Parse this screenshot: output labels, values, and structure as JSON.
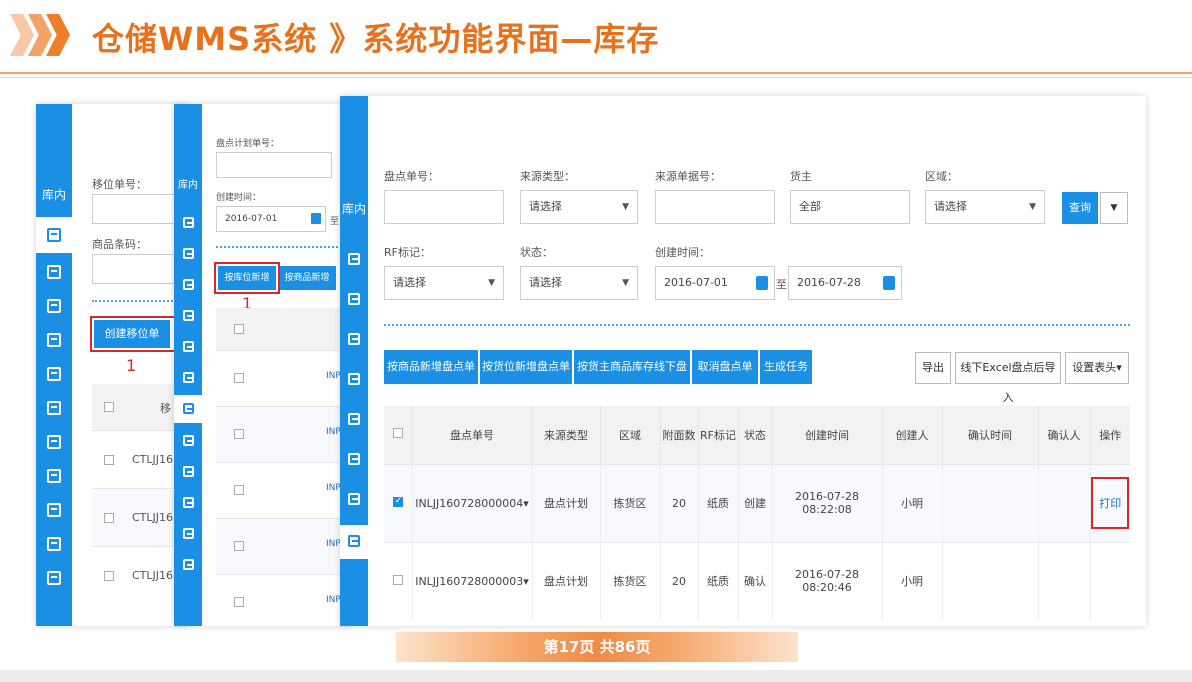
{
  "header": {
    "title": "仓储WMS系统 》系统功能界面—库存",
    "colors": {
      "accent": "#e8711c",
      "brand_blue": "#1a8fe3",
      "highlight_red": "#d9262c"
    }
  },
  "panel_left": {
    "sidebar_title": "库内",
    "field1_label": "移位单号：",
    "field2_label": "商品条码：",
    "create_button": "创建移位单",
    "step_number": "1",
    "table_header_partial": "移",
    "rows": [
      "CTLJJ16(",
      "CTLJJ16(",
      "CTLJJ16("
    ]
  },
  "panel_middle": {
    "sidebar_title": "库内",
    "field1_label": "盘点计划单号：",
    "field2_label": "创建时间：",
    "date_value": "2016-07-01",
    "date_suffix": "至",
    "btn_by_location": "按库位新增",
    "btn_by_product": "按商品新增",
    "step_number": "1",
    "row_prefix": "INPI"
  },
  "panel_main": {
    "sidebar_title": "库内",
    "filters": {
      "order_no_label": "盘点单号：",
      "source_type_label": "来源类型：",
      "source_type_value": "请选择",
      "source_no_label": "来源单据号：",
      "owner_label": "货主",
      "owner_value": "全部",
      "area_label": "区域：",
      "area_value": "请选择",
      "query_button": "查询",
      "rf_label": "RF标记：",
      "rf_value": "请选择",
      "status_label": "状态：",
      "status_value": "请选择",
      "created_label": "创建时间：",
      "date_from": "2016-07-01",
      "date_to_sep": "至",
      "date_to": "2016-07-28"
    },
    "toolbar": {
      "btn1": "按商品新增盘点单",
      "btn2": "按货位新增盘点单",
      "btn3": "按货主商品库存线下盘点",
      "btn4": "取消盘点单",
      "btn5": "生成任务",
      "export": "导出",
      "import": "线下Excel盘点后导入",
      "settings": "设置表头▾"
    },
    "table": {
      "columns": [
        "盘点单号",
        "来源类型",
        "区域",
        "附面数",
        "RF标记",
        "状态",
        "创建时间",
        "创建人",
        "确认时间",
        "确认人",
        "操作"
      ],
      "rows": [
        {
          "no": "INLJJ160728000004▾",
          "source": "盘点计划",
          "area": "拣货区",
          "count": "20",
          "rf": "纸质",
          "status": "创建",
          "created": "2016-07-28 08:22:08",
          "creator": "小明",
          "confirm_time": "",
          "confirmer": "",
          "op": "打印",
          "checked": true
        },
        {
          "no": "INLJJ160728000003▾",
          "source": "盘点计划",
          "area": "拣货区",
          "count": "20",
          "rf": "纸质",
          "status": "确认",
          "created": "2016-07-28 08:20:46",
          "creator": "小明",
          "confirm_time": "",
          "confirmer": "",
          "op": "",
          "checked": false
        }
      ]
    }
  },
  "footer": {
    "page_text": "第17页 共86页"
  }
}
